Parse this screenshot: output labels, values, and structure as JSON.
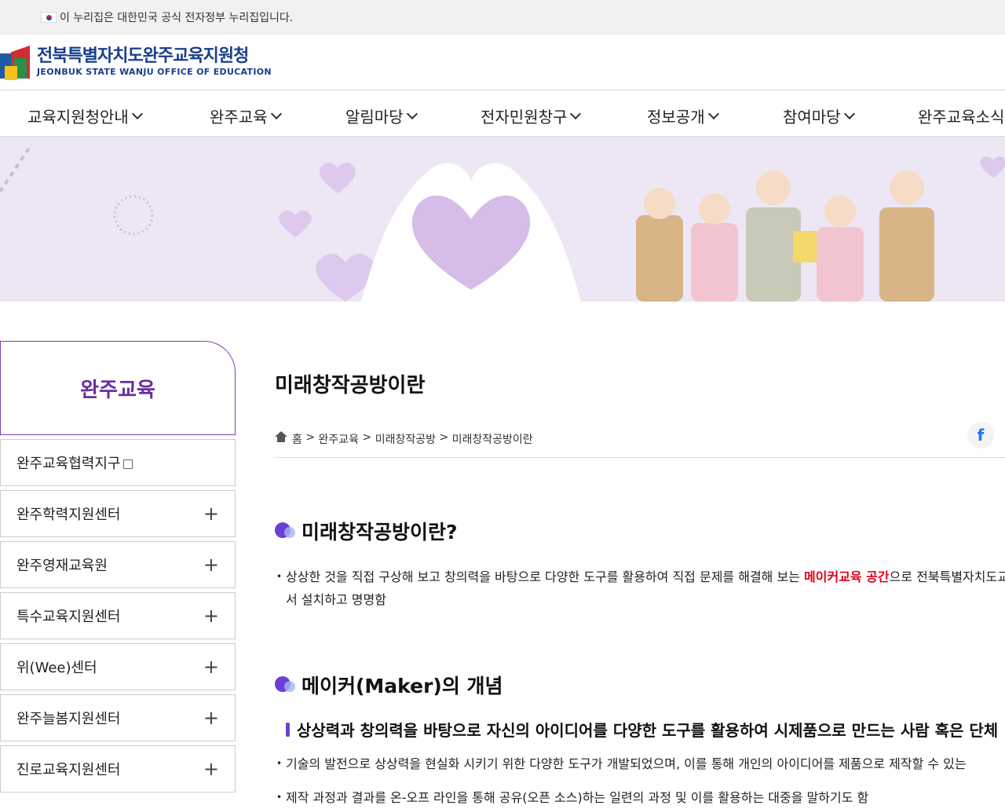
{
  "topbar": {
    "notice": "이 누리집은 대한민국 공식 전자정부 누리집입니다."
  },
  "logo": {
    "name_ko": "전북특별자치도완주교육지원청",
    "name_en": "JEONBUK STATE WANJU OFFICE OF EDUCATION"
  },
  "gnb": [
    {
      "label": "교육지원청안내"
    },
    {
      "label": "완주교육"
    },
    {
      "label": "알림마당"
    },
    {
      "label": "전자민원창구"
    },
    {
      "label": "정보공개"
    },
    {
      "label": "참여마당"
    },
    {
      "label": "완주교육소식"
    }
  ],
  "lnb": {
    "title": "완주교육",
    "items": [
      {
        "label": "완주교육협력지구",
        "icon": "external-link-icon"
      },
      {
        "label": "완주학력지원센터",
        "icon": "plus-icon"
      },
      {
        "label": "완주영재교육원",
        "icon": "plus-icon"
      },
      {
        "label": "특수교육지원센터",
        "icon": "plus-icon"
      },
      {
        "label": "위(Wee)센터",
        "icon": "plus-icon"
      },
      {
        "label": "완주늘봄지원센터",
        "icon": "plus-icon"
      },
      {
        "label": "진로교육지원센터",
        "icon": "plus-icon"
      }
    ],
    "plus": "+"
  },
  "content": {
    "title": "미래창작공방이란",
    "breadcrumb": [
      "홈",
      "완주교육",
      "미래창작공방",
      "미래창작공방이란"
    ],
    "breadcrumb_sep": ">",
    "share_fb": "f",
    "section1": {
      "heading": "미래창작공방이란?",
      "para_pre": "상상한 것을 직접 구상해 보고 창의력을 바탕으로 다양한 도구를 활용하여 직접 문제를 해결해 보는 ",
      "para_highlight": "메이커교육 공간",
      "para_post": "으로 전북특별자치도교육청에",
      "para_line2": "서 설치하고 명명함"
    },
    "section2": {
      "heading": "메이커(Maker)의 개념",
      "subheading": "상상력과 창의력을 바탕으로 자신의 아이디어를 다양한 도구를 활용하여 시제품으로 만드는 사람 혹은 단체",
      "bullet1": "기술의 발전으로 상상력을 현실화 시키기 위한 다양한 도구가 개발되었으며, 이를 통해 개인의 아이디어를 제품으로 제작할 수 있는",
      "bullet2": "제작 과정과 결과를 온-오프 라인을 통해 공유(오픈 소스)하는 일련의 과정 및 이를 활용하는 대중을 말하기도 함"
    }
  },
  "colors": {
    "accent": "#6a3fd8",
    "lnb_border": "#7b3fb0",
    "highlight": "#e0001a",
    "banner_bg": "#ede6f4"
  }
}
